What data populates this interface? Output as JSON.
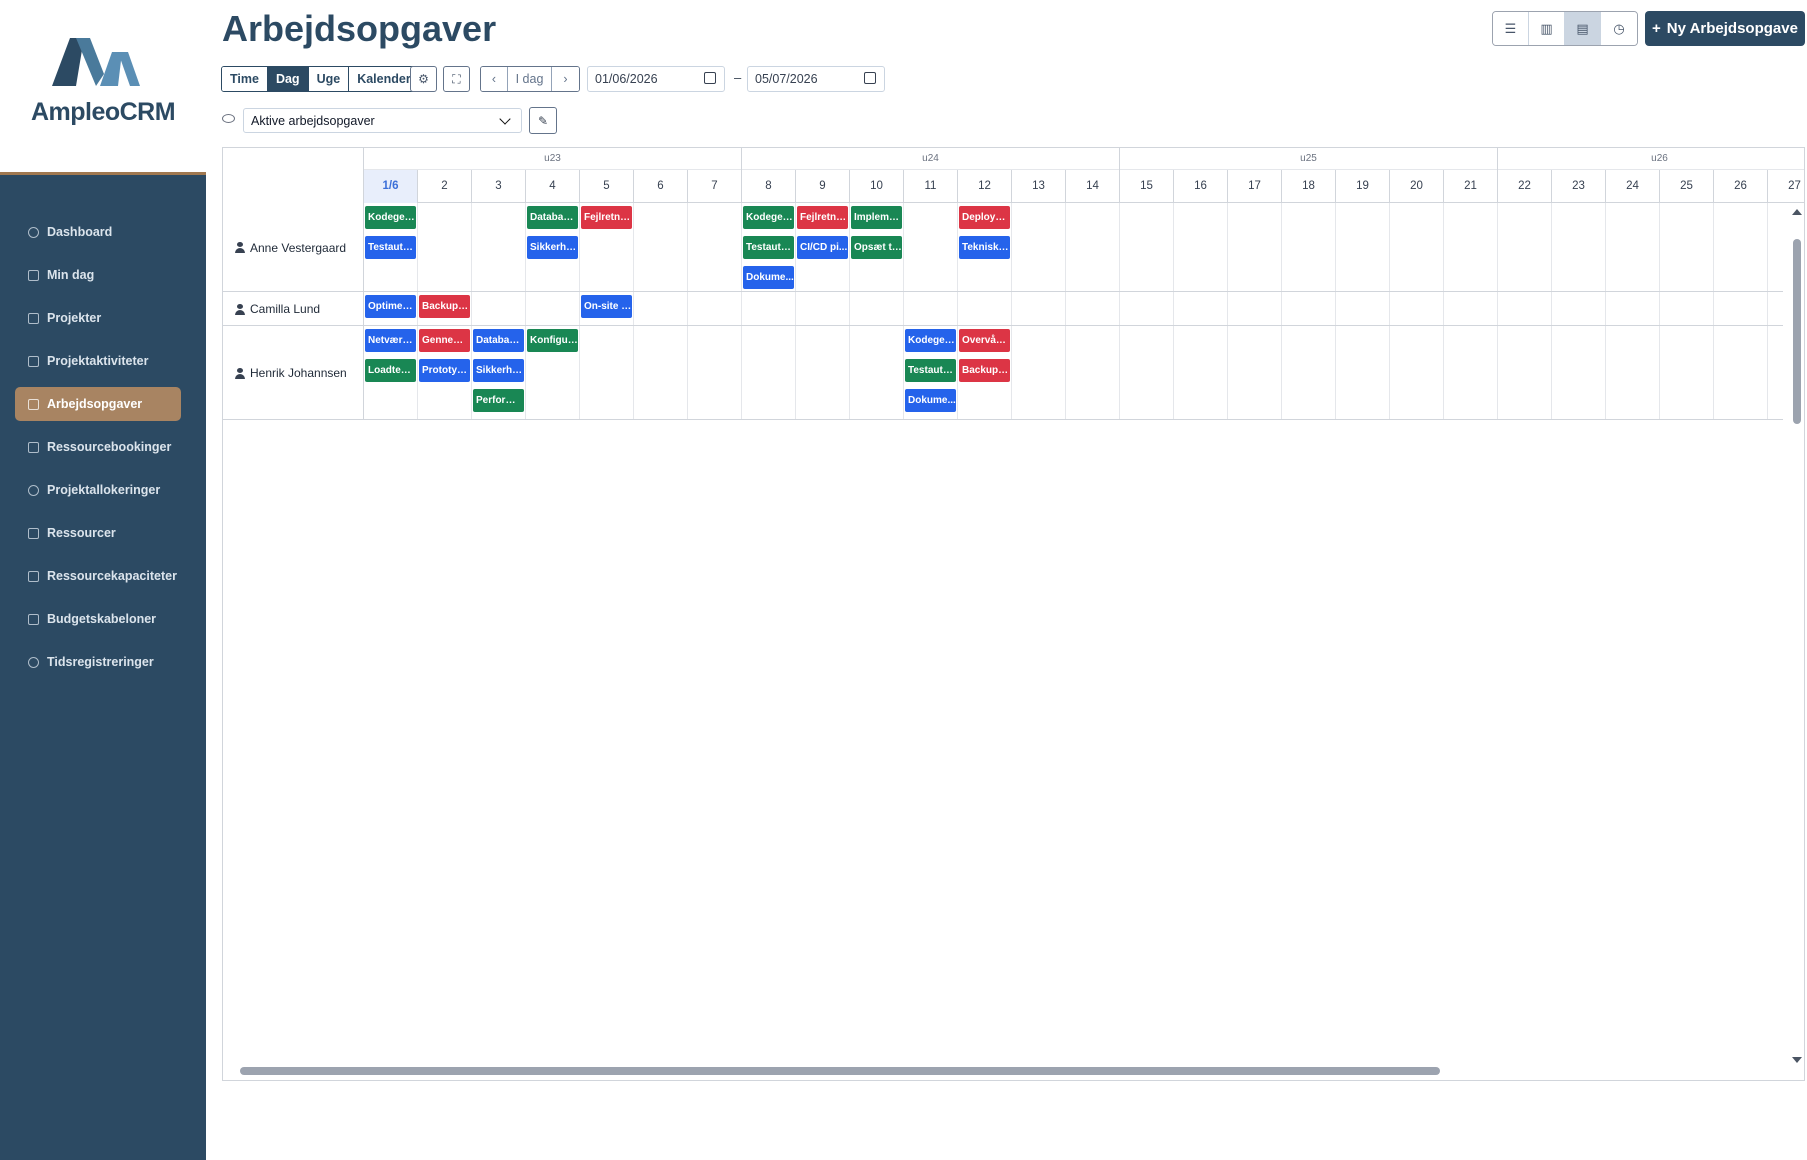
{
  "app": {
    "logo_text": "AmpleoCRM",
    "brand_color": "#2c4a63",
    "accent_color": "#a88462"
  },
  "sidebar": {
    "items": [
      {
        "label": "Dashboard",
        "icon": "dashboard-icon",
        "active": false
      },
      {
        "label": "Min dag",
        "icon": "calendar-check-icon",
        "active": false
      },
      {
        "label": "Projekter",
        "icon": "project-icon",
        "active": false
      },
      {
        "label": "Projektaktiviteter",
        "icon": "sitemap-icon",
        "active": false
      },
      {
        "label": "Arbejdsopgaver",
        "icon": "clipboard-icon",
        "active": true
      },
      {
        "label": "Ressourcebookinger",
        "icon": "booking-icon",
        "active": false
      },
      {
        "label": "Projektallokeringer",
        "icon": "pie-chart-icon",
        "active": false
      },
      {
        "label": "Ressourcer",
        "icon": "resource-icon",
        "active": false
      },
      {
        "label": "Ressourcekapaciteter",
        "icon": "capacity-icon",
        "active": false
      },
      {
        "label": "Budgetskabeloner",
        "icon": "database-icon",
        "active": false
      },
      {
        "label": "Tidsregistreringer",
        "icon": "clock-icon",
        "active": false
      }
    ]
  },
  "header": {
    "title": "Arbejdsopgaver",
    "new_button": "Ny Arbejdsopgave"
  },
  "toolbar": {
    "views": [
      "Time",
      "Dag",
      "Uge",
      "Kalender"
    ],
    "active_view": "Dag",
    "today_label": "I dag",
    "date_from": "01/06/2026",
    "date_to": "05/07/2026",
    "dash": "–"
  },
  "filter": {
    "selected": "Aktive arbejdsopgaver"
  },
  "grid": {
    "weeks": [
      "u23",
      "u24",
      "u25",
      "u26"
    ],
    "days": [
      "1/6",
      "2",
      "3",
      "4",
      "5",
      "6",
      "7",
      "8",
      "9",
      "10",
      "11",
      "12",
      "13",
      "14",
      "15",
      "16",
      "17",
      "18",
      "19",
      "20",
      "21",
      "22",
      "23",
      "24",
      "25",
      "26",
      "27"
    ],
    "rows": [
      {
        "name": "Anne Vestergaard",
        "warning": false,
        "tasks": [
          {
            "day": 0,
            "lane": 0,
            "label": "Kodegen...",
            "color": "green"
          },
          {
            "day": 0,
            "lane": 1,
            "label": "Testauto...",
            "color": "blue"
          },
          {
            "day": 3,
            "lane": 0,
            "label": "Database...",
            "color": "green"
          },
          {
            "day": 3,
            "lane": 1,
            "label": "Sikkerhe...",
            "color": "blue"
          },
          {
            "day": 4,
            "lane": 0,
            "label": "Fejlretnin...",
            "color": "red"
          },
          {
            "day": 7,
            "lane": 0,
            "label": "Kodegen...",
            "color": "green"
          },
          {
            "day": 7,
            "lane": 1,
            "label": "Testauto...",
            "color": "green"
          },
          {
            "day": 7,
            "lane": 2,
            "label": "Dokume...",
            "color": "blue"
          },
          {
            "day": 8,
            "lane": 0,
            "label": "Fejlretnin...",
            "color": "red"
          },
          {
            "day": 8,
            "lane": 1,
            "label": "CI/CD pi...",
            "color": "blue"
          },
          {
            "day": 9,
            "lane": 0,
            "label": "Impleme...",
            "color": "green"
          },
          {
            "day": 9,
            "lane": 1,
            "label": "Opsæt te...",
            "color": "green"
          },
          {
            "day": 11,
            "lane": 0,
            "label": "Deploym...",
            "color": "red"
          },
          {
            "day": 11,
            "lane": 1,
            "label": "Teknisk g...",
            "color": "blue"
          }
        ]
      },
      {
        "name": "Camilla Lund",
        "warning": false,
        "tasks": [
          {
            "day": 0,
            "lane": 0,
            "label": "Optimer ...",
            "color": "blue"
          },
          {
            "day": 1,
            "lane": 0,
            "label": "Backup-s...",
            "color": "red"
          },
          {
            "day": 4,
            "lane": 0,
            "label": "On-site s...",
            "color": "blue"
          }
        ]
      },
      {
        "name": "Henrik Johannsen",
        "warning": false,
        "tasks": [
          {
            "day": 0,
            "lane": 0,
            "label": "Netværk...",
            "color": "blue"
          },
          {
            "day": 0,
            "lane": 1,
            "label": "Loadtest ...",
            "color": "green"
          },
          {
            "day": 1,
            "lane": 0,
            "label": "Gennemf...",
            "color": "red"
          },
          {
            "day": 1,
            "lane": 1,
            "label": "Prototyp...",
            "color": "blue"
          },
          {
            "day": 2,
            "lane": 0,
            "label": "Database...",
            "color": "blue"
          },
          {
            "day": 2,
            "lane": 1,
            "label": "Sikkerhe...",
            "color": "blue"
          },
          {
            "day": 2,
            "lane": 2,
            "label": "Performa...",
            "color": "green"
          },
          {
            "day": 3,
            "lane": 0,
            "label": "Konfigur...",
            "color": "green"
          },
          {
            "day": 10,
            "lane": 0,
            "label": "Kodegen...",
            "color": "blue"
          },
          {
            "day": 10,
            "lane": 1,
            "label": "Testauto...",
            "color": "green"
          },
          {
            "day": 10,
            "lane": 2,
            "label": "Dokume...",
            "color": "blue"
          },
          {
            "day": 11,
            "lane": 0,
            "label": "Overvåg...",
            "color": "red"
          },
          {
            "day": 11,
            "lane": 1,
            "label": "Backup-s...",
            "color": "red"
          }
        ]
      }
    ]
  }
}
